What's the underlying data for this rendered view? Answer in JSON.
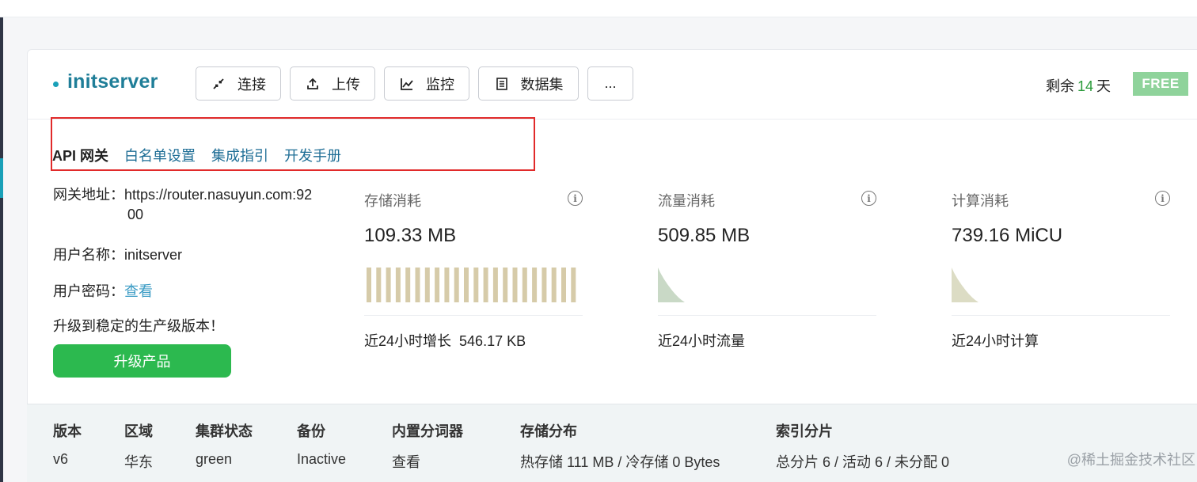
{
  "header": {
    "server_name": "initserver",
    "toolbar": [
      {
        "label": "连接",
        "icon": "connect-icon"
      },
      {
        "label": "上传",
        "icon": "upload-icon"
      },
      {
        "label": "监控",
        "icon": "monitor-chart-icon"
      },
      {
        "label": "数据集",
        "icon": "dataset-icon"
      },
      {
        "label": "...",
        "icon": ""
      }
    ],
    "remain_prefix": "剩余",
    "remain_days": "14",
    "remain_suffix": "天",
    "plan_badge": "FREE"
  },
  "tabs": [
    {
      "label": "API 网关",
      "active": true
    },
    {
      "label": "白名单设置",
      "active": false
    },
    {
      "label": "集成指引",
      "active": false
    },
    {
      "label": "开发手册",
      "active": false
    }
  ],
  "gateway": {
    "address_label": "网关地址：",
    "address_line1": "https://router.nasuyun.com:92",
    "address_line2": "00",
    "username_label": "用户名称：",
    "username": "initserver",
    "password_label": "用户密码：",
    "password_link": "查看",
    "upgrade_text": "升级到稳定的生产级版本！",
    "upgrade_button": "升级产品"
  },
  "metrics": [
    {
      "title": "存储消耗",
      "value": "109.33 MB",
      "footer_label": "近24小时增长",
      "footer_value": "546.17 KB",
      "chart_color": "#d6cba9",
      "chart_kind": "bars",
      "bar_count": 22
    },
    {
      "title": "流量消耗",
      "value": "509.85 MB",
      "footer_label": "近24小时流量",
      "footer_value": "",
      "chart_color": "#c9d9c6",
      "chart_kind": "decay"
    },
    {
      "title": "计算消耗",
      "value": "739.16 MiCU",
      "footer_label": "近24小时计算",
      "footer_value": "",
      "chart_color": "#dcdcc4",
      "chart_kind": "decay"
    }
  ],
  "summary": [
    {
      "header": "版本",
      "value": "v6",
      "link": false
    },
    {
      "header": "区域",
      "value": "华东",
      "link": false
    },
    {
      "header": "集群状态",
      "value": "green",
      "link": false
    },
    {
      "header": "备份",
      "value": "Inactive",
      "link": false
    },
    {
      "header": "内置分词器",
      "value": "查看",
      "link": true
    },
    {
      "header": "存储分布",
      "value": "热存储 111 MB / 冷存储 0 Bytes",
      "link": false
    },
    {
      "header": "索引分片",
      "value": "总分片 6 / 活动 6 / 未分配 0",
      "link": false
    }
  ],
  "watermark": "@稀土掘金技术社区",
  "colors": {
    "brand": "#1f7e98",
    "link": "#1f6e96",
    "primary_button": "#2cb94f",
    "free_badge": "#8fd39b",
    "highlight": "#e12a2a"
  }
}
